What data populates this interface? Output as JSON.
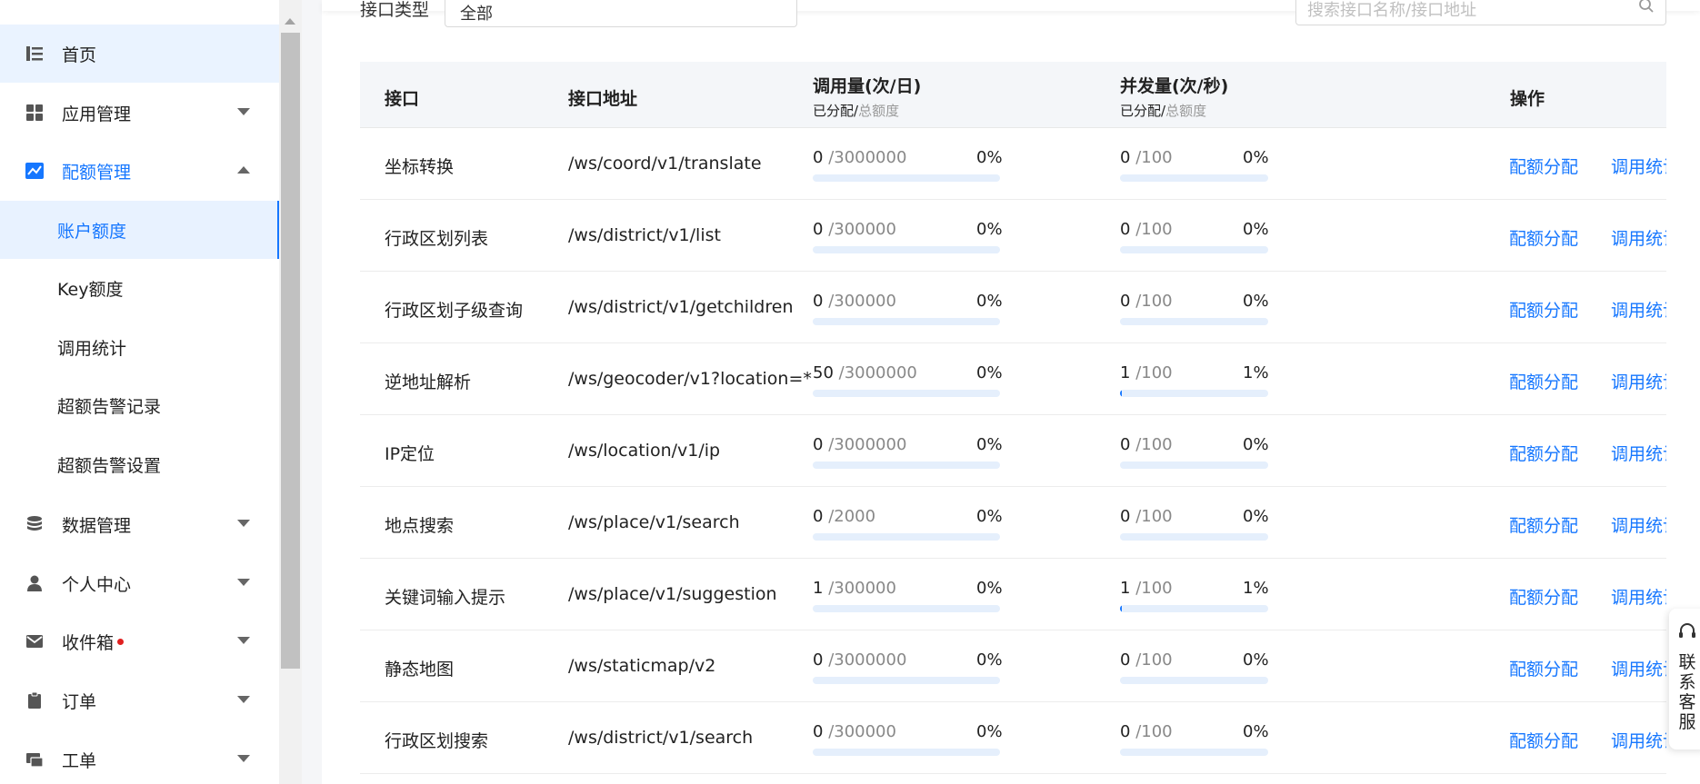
{
  "sidebar": {
    "items": [
      {
        "label": "首页",
        "icon": "list-icon"
      },
      {
        "label": "应用管理",
        "icon": "grid-icon"
      },
      {
        "label": "配额管理",
        "icon": "chart-icon"
      },
      {
        "label": "数据管理",
        "icon": "database-icon"
      },
      {
        "label": "个人中心",
        "icon": "user-icon"
      },
      {
        "label": "收件箱",
        "icon": "mail-icon"
      },
      {
        "label": "订单",
        "icon": "clipboard-icon"
      },
      {
        "label": "工单",
        "icon": "ticket-icon"
      }
    ],
    "sub_items": [
      {
        "label": "账户额度"
      },
      {
        "label": "Key额度"
      },
      {
        "label": "调用统计"
      },
      {
        "label": "超额告警记录"
      },
      {
        "label": "超额告警设置"
      }
    ]
  },
  "filters": {
    "type_label": "接口类型",
    "type_value": "全部",
    "search_placeholder": "搜索接口名称/接口地址"
  },
  "table": {
    "headers": {
      "name": "接口",
      "path": "接口地址",
      "calls": "调用量(次/日)",
      "concurrency": "并发量(次/秒)",
      "actions": "操作",
      "sub_allocated": "已分配/",
      "sub_total": "总额度"
    },
    "action_labels": {
      "allocate": "配额分配",
      "stats": "调用统计"
    },
    "rows": [
      {
        "name": "坐标转换",
        "path": "/ws/coord/v1/translate",
        "calls_used": "0",
        "calls_total": "/3000000",
        "calls_pct": "0%",
        "calls_ratio": 0,
        "conc_used": "0",
        "conc_total": "/100",
        "conc_pct": "0%",
        "conc_ratio": 0
      },
      {
        "name": "行政区划列表",
        "path": "/ws/district/v1/list",
        "calls_used": "0",
        "calls_total": "/300000",
        "calls_pct": "0%",
        "calls_ratio": 0,
        "conc_used": "0",
        "conc_total": "/100",
        "conc_pct": "0%",
        "conc_ratio": 0
      },
      {
        "name": "行政区划子级查询",
        "path": "/ws/district/v1/getchildren",
        "calls_used": "0",
        "calls_total": "/300000",
        "calls_pct": "0%",
        "calls_ratio": 0,
        "conc_used": "0",
        "conc_total": "/100",
        "conc_pct": "0%",
        "conc_ratio": 0
      },
      {
        "name": "逆地址解析",
        "path": "/ws/geocoder/v1?location=*",
        "calls_used": "50",
        "calls_total": "/3000000",
        "calls_pct": "0%",
        "calls_ratio": 0,
        "conc_used": "1",
        "conc_total": "/100",
        "conc_pct": "1%",
        "conc_ratio": 0.01
      },
      {
        "name": "IP定位",
        "path": "/ws/location/v1/ip",
        "calls_used": "0",
        "calls_total": "/3000000",
        "calls_pct": "0%",
        "calls_ratio": 0,
        "conc_used": "0",
        "conc_total": "/100",
        "conc_pct": "0%",
        "conc_ratio": 0
      },
      {
        "name": "地点搜索",
        "path": "/ws/place/v1/search",
        "calls_used": "0",
        "calls_total": "/2000",
        "calls_pct": "0%",
        "calls_ratio": 0,
        "conc_used": "0",
        "conc_total": "/100",
        "conc_pct": "0%",
        "conc_ratio": 0
      },
      {
        "name": "关键词输入提示",
        "path": "/ws/place/v1/suggestion",
        "calls_used": "1",
        "calls_total": "/300000",
        "calls_pct": "0%",
        "calls_ratio": 0,
        "conc_used": "1",
        "conc_total": "/100",
        "conc_pct": "1%",
        "conc_ratio": 0.01
      },
      {
        "name": "静态地图",
        "path": "/ws/staticmap/v2",
        "calls_used": "0",
        "calls_total": "/3000000",
        "calls_pct": "0%",
        "calls_ratio": 0,
        "conc_used": "0",
        "conc_total": "/100",
        "conc_pct": "0%",
        "conc_ratio": 0
      },
      {
        "name": "行政区划搜索",
        "path": "/ws/district/v1/search",
        "calls_used": "0",
        "calls_total": "/300000",
        "calls_pct": "0%",
        "calls_ratio": 0,
        "conc_used": "0",
        "conc_total": "/100",
        "conc_pct": "0%",
        "conc_ratio": 0
      }
    ]
  },
  "float_contact": {
    "label": "联系客服",
    "icon": "headset-icon"
  },
  "colors": {
    "accent": "#1677ff",
    "badge_red": "#e02020"
  }
}
